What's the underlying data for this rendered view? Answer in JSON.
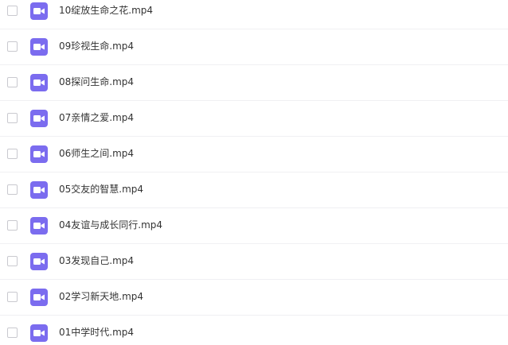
{
  "files": [
    {
      "name": "10绽放生命之花.mp4",
      "icon": "video-file-icon"
    },
    {
      "name": "09珍视生命.mp4",
      "icon": "video-file-icon"
    },
    {
      "name": "08探问生命.mp4",
      "icon": "video-file-icon"
    },
    {
      "name": "07亲情之爱.mp4",
      "icon": "video-file-icon"
    },
    {
      "name": "06师生之间.mp4",
      "icon": "video-file-icon"
    },
    {
      "name": "05交友的智慧.mp4",
      "icon": "video-file-icon"
    },
    {
      "name": "04友谊与成长同行.mp4",
      "icon": "video-file-icon"
    },
    {
      "name": "03发现自己.mp4",
      "icon": "video-file-icon"
    },
    {
      "name": "02学习新天地.mp4",
      "icon": "video-file-icon"
    },
    {
      "name": "01中学时代.mp4",
      "icon": "video-file-icon"
    }
  ],
  "colors": {
    "icon_background": "#7b6cef",
    "text": "#333333",
    "row_divider": "#f0f0f3"
  }
}
